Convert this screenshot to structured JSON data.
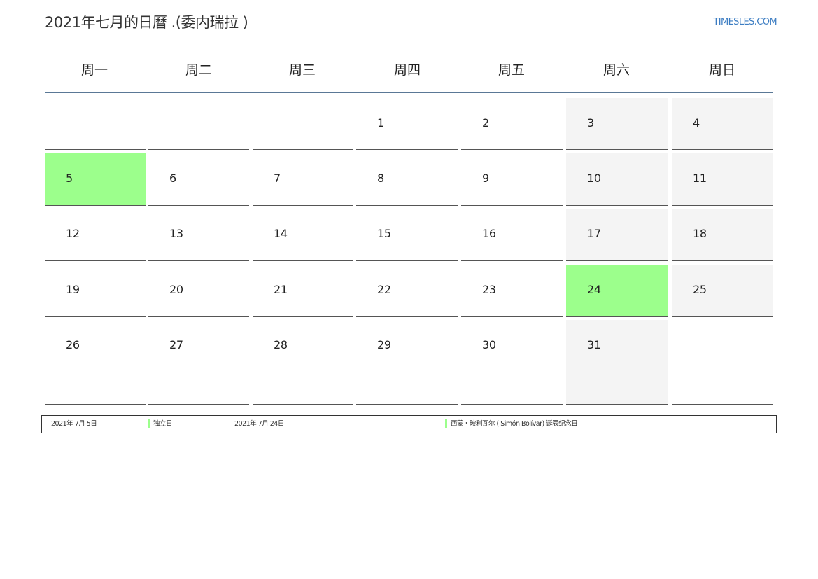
{
  "header": {
    "title": "2021年七月的日曆 .(委内瑞拉 )",
    "site": "TIMESLES.COM"
  },
  "weekdays": [
    "周一",
    "周二",
    "周三",
    "周四",
    "周五",
    "周六",
    "周日"
  ],
  "colors": {
    "holiday": "#9cff8c",
    "weekend": "#f4f4f4",
    "rule": "#5a7896",
    "link": "#3b7cc2"
  },
  "weeks": [
    [
      "",
      "",
      "",
      "1",
      "2",
      "3",
      "4"
    ],
    [
      "5",
      "6",
      "7",
      "8",
      "9",
      "10",
      "11"
    ],
    [
      "12",
      "13",
      "14",
      "15",
      "16",
      "17",
      "18"
    ],
    [
      "19",
      "20",
      "21",
      "22",
      "23",
      "24",
      "25"
    ],
    [
      "26",
      "27",
      "28",
      "29",
      "30",
      "31",
      ""
    ]
  ],
  "holiday_days": [
    "5",
    "24"
  ],
  "legend": [
    {
      "date": "2021年 7月 5日",
      "name": "独立日"
    },
    {
      "date": "2021年 7月 24日",
      "name": "西蒙・玻利瓦尔 ( Simón Bolívar) 诞辰纪念日"
    }
  ]
}
